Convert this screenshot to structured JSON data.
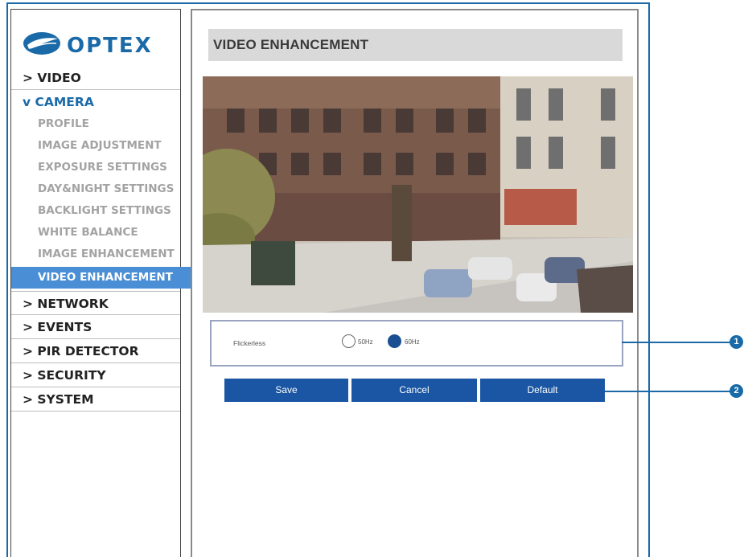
{
  "brand": {
    "logo_text": "OPTEX",
    "color": "#1a6aa8"
  },
  "sidebar": {
    "main_items": [
      {
        "label": "> VIDEO"
      },
      {
        "label": "v CAMERA"
      },
      {
        "label": "> NETWORK"
      },
      {
        "label": "> EVENTS"
      },
      {
        "label": "> PIR DETECTOR"
      },
      {
        "label": "> SECURITY"
      },
      {
        "label": "> SYSTEM"
      }
    ],
    "camera_sub_items": [
      {
        "label": "PROFILE"
      },
      {
        "label": "IMAGE ADJUSTMENT"
      },
      {
        "label": "EXPOSURE SETTINGS"
      },
      {
        "label": "DAY&NIGHT SETTINGS"
      },
      {
        "label": "BACKLIGHT SETTINGS"
      },
      {
        "label": "WHITE BALANCE"
      },
      {
        "label": "IMAGE ENHANCEMENT"
      },
      {
        "label": "VIDEO ENHANCEMENT"
      }
    ],
    "selected_sub_item": "VIDEO ENHANCEMENT"
  },
  "page": {
    "title": "VIDEO ENHANCEMENT"
  },
  "video_preview": {
    "description_icon": "camera-preview"
  },
  "flickerless": {
    "label": "Flickerless",
    "options": [
      "50Hz",
      "60Hz"
    ],
    "selected": "60Hz"
  },
  "buttons": {
    "save": "Save",
    "cancel": "Cancel",
    "default": "Default"
  },
  "callouts": [
    "1",
    "2"
  ],
  "colors": {
    "accent": "#1a6aa8",
    "selected_item": "#4a8fd6",
    "button": "#1a56a3",
    "title_bar": "#d9d9d9"
  }
}
